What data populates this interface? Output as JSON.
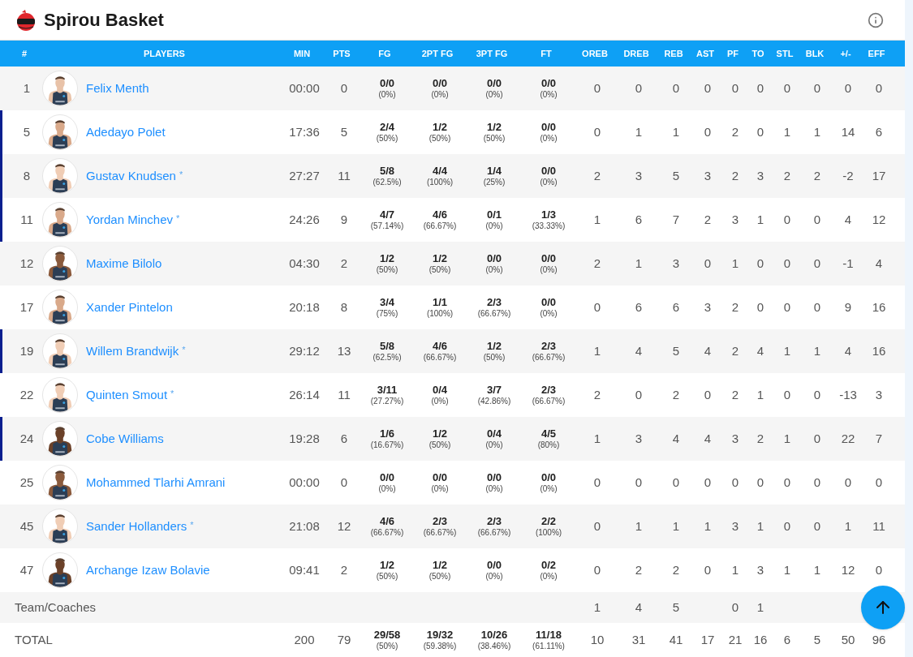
{
  "team": {
    "name": "Spirou Basket"
  },
  "columns": [
    "#",
    "PLAYERS",
    "MIN",
    "PTS",
    "FG",
    "2PT FG",
    "3PT FG",
    "FT",
    "OREB",
    "DREB",
    "REB",
    "AST",
    "PF",
    "TO",
    "STL",
    "BLK",
    "+/-",
    "EFF"
  ],
  "players": [
    {
      "number": "1",
      "name": "Felix Menth",
      "starter": false,
      "min": "00:00",
      "pts": "0",
      "shooting": [
        [
          "0/0",
          "(0%)"
        ],
        [
          "0/0",
          "(0%)"
        ],
        [
          "0/0",
          "(0%)"
        ],
        [
          "0/0",
          "(0%)"
        ]
      ],
      "counts": [
        "0",
        "0",
        "0",
        "0",
        "0",
        "0",
        "0",
        "0",
        "0",
        "0"
      ]
    },
    {
      "number": "5",
      "name": "Adedayo Polet",
      "starter": true,
      "min": "17:36",
      "pts": "5",
      "shooting": [
        [
          "2/4",
          "(50%)"
        ],
        [
          "1/2",
          "(50%)"
        ],
        [
          "1/2",
          "(50%)"
        ],
        [
          "0/0",
          "(0%)"
        ]
      ],
      "counts": [
        "0",
        "1",
        "1",
        "0",
        "2",
        "0",
        "1",
        "1",
        "14",
        "6"
      ]
    },
    {
      "number": "8",
      "name": "Gustav Knudsen",
      "note": "*",
      "starter": true,
      "min": "27:27",
      "pts": "11",
      "shooting": [
        [
          "5/8",
          "(62.5%)"
        ],
        [
          "4/4",
          "(100%)"
        ],
        [
          "1/4",
          "(25%)"
        ],
        [
          "0/0",
          "(0%)"
        ]
      ],
      "counts": [
        "2",
        "3",
        "5",
        "3",
        "2",
        "3",
        "2",
        "2",
        "-2",
        "17"
      ]
    },
    {
      "number": "11",
      "name": "Yordan Minchev",
      "note": "*",
      "starter": true,
      "min": "24:26",
      "pts": "9",
      "shooting": [
        [
          "4/7",
          "(57.14%)"
        ],
        [
          "4/6",
          "(66.67%)"
        ],
        [
          "0/1",
          "(0%)"
        ],
        [
          "1/3",
          "(33.33%)"
        ]
      ],
      "counts": [
        "1",
        "6",
        "7",
        "2",
        "3",
        "1",
        "0",
        "0",
        "4",
        "12"
      ]
    },
    {
      "number": "12",
      "name": "Maxime Bilolo",
      "starter": false,
      "min": "04:30",
      "pts": "2",
      "shooting": [
        [
          "1/2",
          "(50%)"
        ],
        [
          "1/2",
          "(50%)"
        ],
        [
          "0/0",
          "(0%)"
        ],
        [
          "0/0",
          "(0%)"
        ]
      ],
      "counts": [
        "2",
        "1",
        "3",
        "0",
        "1",
        "0",
        "0",
        "0",
        "-1",
        "4"
      ]
    },
    {
      "number": "17",
      "name": "Xander Pintelon",
      "starter": false,
      "min": "20:18",
      "pts": "8",
      "shooting": [
        [
          "3/4",
          "(75%)"
        ],
        [
          "1/1",
          "(100%)"
        ],
        [
          "2/3",
          "(66.67%)"
        ],
        [
          "0/0",
          "(0%)"
        ]
      ],
      "counts": [
        "0",
        "6",
        "6",
        "3",
        "2",
        "0",
        "0",
        "0",
        "9",
        "16"
      ]
    },
    {
      "number": "19",
      "name": "Willem Brandwijk",
      "note": "*",
      "starter": true,
      "min": "29:12",
      "pts": "13",
      "shooting": [
        [
          "5/8",
          "(62.5%)"
        ],
        [
          "4/6",
          "(66.67%)"
        ],
        [
          "1/2",
          "(50%)"
        ],
        [
          "2/3",
          "(66.67%)"
        ]
      ],
      "counts": [
        "1",
        "4",
        "5",
        "4",
        "2",
        "4",
        "1",
        "1",
        "4",
        "16"
      ]
    },
    {
      "number": "22",
      "name": "Quinten Smout",
      "note": "*",
      "starter": false,
      "min": "26:14",
      "pts": "11",
      "shooting": [
        [
          "3/11",
          "(27.27%)"
        ],
        [
          "0/4",
          "(0%)"
        ],
        [
          "3/7",
          "(42.86%)"
        ],
        [
          "2/3",
          "(66.67%)"
        ]
      ],
      "counts": [
        "2",
        "0",
        "2",
        "0",
        "2",
        "1",
        "0",
        "0",
        "-13",
        "3"
      ]
    },
    {
      "number": "24",
      "name": "Cobe Williams",
      "starter": true,
      "min": "19:28",
      "pts": "6",
      "shooting": [
        [
          "1/6",
          "(16.67%)"
        ],
        [
          "1/2",
          "(50%)"
        ],
        [
          "0/4",
          "(0%)"
        ],
        [
          "4/5",
          "(80%)"
        ]
      ],
      "counts": [
        "1",
        "3",
        "4",
        "4",
        "3",
        "2",
        "1",
        "0",
        "22",
        "7"
      ]
    },
    {
      "number": "25",
      "name": "Mohammed Tlarhi Amrani",
      "starter": false,
      "min": "00:00",
      "pts": "0",
      "shooting": [
        [
          "0/0",
          "(0%)"
        ],
        [
          "0/0",
          "(0%)"
        ],
        [
          "0/0",
          "(0%)"
        ],
        [
          "0/0",
          "(0%)"
        ]
      ],
      "counts": [
        "0",
        "0",
        "0",
        "0",
        "0",
        "0",
        "0",
        "0",
        "0",
        "0"
      ]
    },
    {
      "number": "45",
      "name": "Sander Hollanders",
      "note": "*",
      "starter": false,
      "min": "21:08",
      "pts": "12",
      "shooting": [
        [
          "4/6",
          "(66.67%)"
        ],
        [
          "2/3",
          "(66.67%)"
        ],
        [
          "2/3",
          "(66.67%)"
        ],
        [
          "2/2",
          "(100%)"
        ]
      ],
      "counts": [
        "0",
        "1",
        "1",
        "1",
        "3",
        "1",
        "0",
        "0",
        "1",
        "11"
      ]
    },
    {
      "number": "47",
      "name": "Archange Izaw Bolavie",
      "starter": false,
      "min": "09:41",
      "pts": "2",
      "shooting": [
        [
          "1/2",
          "(50%)"
        ],
        [
          "1/2",
          "(50%)"
        ],
        [
          "0/0",
          "(0%)"
        ],
        [
          "0/2",
          "(0%)"
        ]
      ],
      "counts": [
        "0",
        "2",
        "2",
        "0",
        "1",
        "3",
        "1",
        "1",
        "12",
        "0"
      ]
    }
  ],
  "team_row": {
    "label": "Team/Coaches",
    "counts": {
      "oreb": "1",
      "dreb": "4",
      "reb": "5",
      "pf": "0",
      "to": "1"
    }
  },
  "total_row": {
    "label": "TOTAL",
    "min": "200",
    "pts": "79",
    "shooting": [
      [
        "29/58",
        "(50%)"
      ],
      [
        "19/32",
        "(59.38%)"
      ],
      [
        "10/26",
        "(38.46%)"
      ],
      [
        "11/18",
        "(61.11%)"
      ]
    ],
    "counts": [
      "10",
      "31",
      "41",
      "17",
      "21",
      "16",
      "6",
      "5",
      "50",
      "96"
    ]
  }
}
